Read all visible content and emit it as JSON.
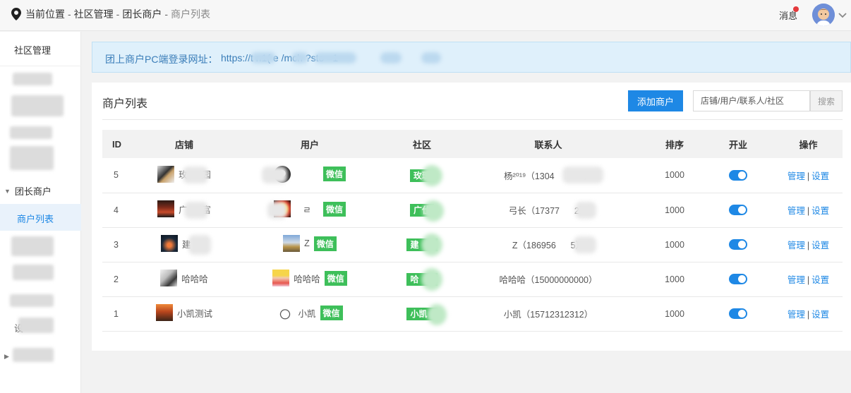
{
  "breadcrumb": {
    "label": "当前位置",
    "sep": "-",
    "items": [
      "社区管理",
      "团长商户"
    ],
    "current": "商户列表"
  },
  "header": {
    "message_label": "消息"
  },
  "sidebar": {
    "title": "社区管理",
    "group_label": "团长商户",
    "active_item": "商户列表",
    "fragments": [
      "商",
      "设"
    ]
  },
  "banner": {
    "label": "团上商户PC端登录网址：",
    "url": "https://t    n1(    e    /mch    ?sto    =1"
  },
  "panel": {
    "title": "商户列表",
    "add_button": "添加商户",
    "search_placeholder": "店铺/用户/联系人/社区",
    "search_button": "搜索"
  },
  "table": {
    "columns": [
      "ID",
      "店铺",
      "用户",
      "社区",
      "联系人",
      "排序",
      "开业",
      "操作"
    ],
    "wechat_tag": "微信",
    "action_manage": "管理",
    "action_sep": "|",
    "action_settings": "设置",
    "rows": [
      {
        "id": "5",
        "shop": "玫",
        "shop_tail": "园",
        "user": "",
        "community": "玫瑰",
        "contact": "杨²⁰¹⁹（1304",
        "contact_tail": "）",
        "sort": "1000",
        "open": true
      },
      {
        "id": "4",
        "shop": "广",
        "shop_tail": "富",
        "user": "ㄹ",
        "community": "广仕",
        "contact": "弓长（17377",
        "contact_tail": "2）",
        "sort": "1000",
        "open": true
      },
      {
        "id": "3",
        "shop": "建",
        "shop_tail": "",
        "user": "Z",
        "community": "建",
        "contact": "Z（186956",
        "contact_tail": "5）",
        "sort": "1000",
        "open": true
      },
      {
        "id": "2",
        "shop": "哈哈哈",
        "shop_tail": "",
        "user": "哈哈哈",
        "community": "哈",
        "contact": "哈哈哈（15000000000）",
        "contact_tail": "",
        "sort": "1000",
        "open": true
      },
      {
        "id": "1",
        "shop": "小凯测试",
        "shop_tail": "",
        "user": "小凯",
        "community": "小凯",
        "contact": "小凯（15712312312）",
        "contact_tail": "",
        "sort": "1000",
        "open": true
      }
    ]
  },
  "colors": {
    "primary": "#1e88e5",
    "wechat_green": "#3ebf5a",
    "banner_bg": "#dff0fb"
  }
}
